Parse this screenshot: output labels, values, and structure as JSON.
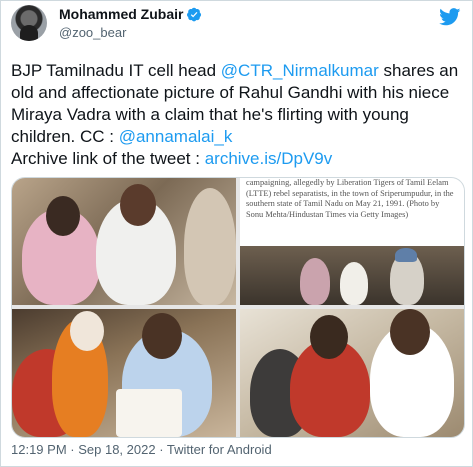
{
  "author": {
    "name": "Mohammed Zubair",
    "handle": "@zoo_bear",
    "verified": true
  },
  "tweet": {
    "part1": "BJP Tamilnadu IT cell head ",
    "mention1": "@CTR_Nirmalkumar",
    "part2": " shares an old and affectionate picture of Rahul Gandhi with his niece Miraya Vadra with a claim that he's flirting with young children. CC : ",
    "mention2": "@annamalai_k",
    "part3": "Archive link of the tweet : ",
    "link": "archive.is/DpV9v"
  },
  "media": {
    "caption_text": "campaigning, allegedly by Liberation Tigers of Tamil Eelam (LTTE) rebel separatists, in the town of Sriperumpudur, in the southern state of Tamil Nadu on May 21, 1991. (Photo by Sonu Mehta/Hindustan Times via Getty Images)"
  },
  "footer": {
    "time": "12:19 PM",
    "separator": " · ",
    "date": "Sep 18, 2022",
    "source": "Twitter for Android"
  },
  "colors": {
    "link": "#1d9bf0",
    "text": "#0f1419",
    "secondary": "#536471",
    "border": "#cfd9de"
  }
}
